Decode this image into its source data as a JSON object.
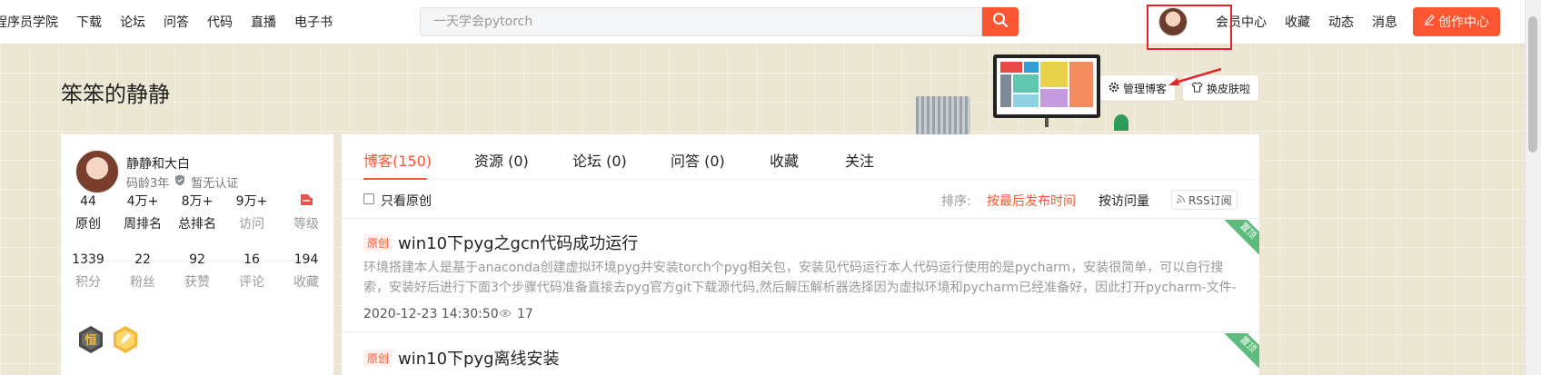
{
  "nav": {
    "links": [
      "程序员学院",
      "下载",
      "论坛",
      "问答",
      "代码",
      "直播",
      "电子书"
    ],
    "search_placeholder": "一天学会pytorch",
    "user_links": [
      "会员中心",
      "收藏",
      "动态",
      "消息"
    ],
    "create_label": "创作中心"
  },
  "banner": {
    "blog_title": "笨笨的静静",
    "manage_label": "管理博客",
    "skin_label": "换皮肤啦"
  },
  "profile": {
    "name": "静静和大白",
    "years": "码龄3年",
    "cert": "暂无认证",
    "stats_row1": [
      {
        "value": "44",
        "label": "原创"
      },
      {
        "value": "4万+",
        "label": "周排名"
      },
      {
        "value": "8万+",
        "label": "总排名"
      },
      {
        "value": "9万+",
        "label": "访问"
      },
      {
        "value": "",
        "label": "等级"
      }
    ],
    "stats_row2": [
      {
        "value": "1339",
        "label": "积分"
      },
      {
        "value": "22",
        "label": "粉丝"
      },
      {
        "value": "92",
        "label": "获赞"
      },
      {
        "value": "16",
        "label": "评论"
      },
      {
        "value": "194",
        "label": "收藏"
      }
    ],
    "badge1_text": "恒"
  },
  "tabs": [
    "博客(150)",
    "资源 (0)",
    "论坛 (0)",
    "问答 (0)",
    "收藏",
    "关注"
  ],
  "filter": {
    "only_original": "只看原创",
    "sort_label": "排序:",
    "sort_by_time": "按最后发布时间",
    "sort_by_visits": "按访问量",
    "rss": "RSS订阅"
  },
  "articles": [
    {
      "tag": "原创",
      "title": "win10下pyg之gcn代码成功运行",
      "summary": "环境搭建本人是基于anaconda创建虚拟环境pyg并安装torch个pyg相关包，安装见代码运行本人代码运行使用的是pycharm，安装很简单，可以自行搜索，安装好后进行下面3个步骤代码准备直接去pyg官方git下载源代码,然后解压解析器选择因为虚拟环境和pycharm已经准备好，因此打开pycharm-文件-open-选…",
      "date": "2020-12-23 14:30:50",
      "views": "17",
      "corner": "置顶"
    },
    {
      "tag": "原创",
      "title": "win10下pyg离线安装",
      "corner": "置顶"
    }
  ],
  "colors": {
    "accent": "#fc5531",
    "annotation": "#e3262b"
  }
}
